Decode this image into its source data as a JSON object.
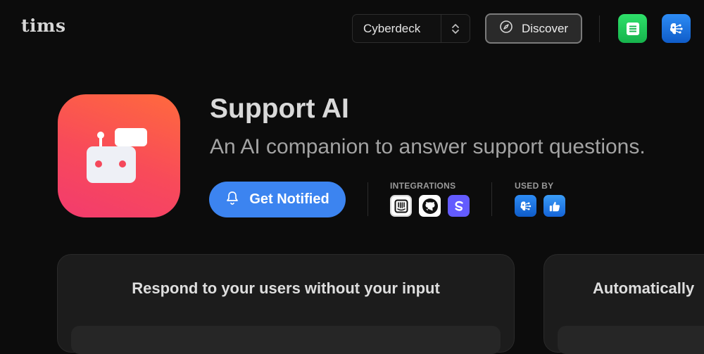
{
  "header": {
    "logo": "tims",
    "workspace": "Cyberdeck",
    "discover_label": "Discover"
  },
  "product": {
    "title": "Support AI",
    "subtitle": "An AI companion to answer support questions.",
    "notify_label": "Get Notified"
  },
  "integrations": {
    "label": "INTEGRATIONS",
    "items": [
      "intercom-icon",
      "github-icon",
      "stripe-icon"
    ]
  },
  "used_by": {
    "label": "USED BY",
    "items": [
      "brain-app-icon",
      "thumbs-up-app-icon"
    ]
  },
  "cards": [
    {
      "title": "Respond to your users without your input"
    },
    {
      "title": "Automatically"
    }
  ],
  "colors": {
    "background": "#0c0c0c",
    "accent_blue": "#3c84f0",
    "app_icon_gradient": [
      "#ff6a3d",
      "#f23b6e"
    ],
    "notes_green": "#22c55e"
  }
}
